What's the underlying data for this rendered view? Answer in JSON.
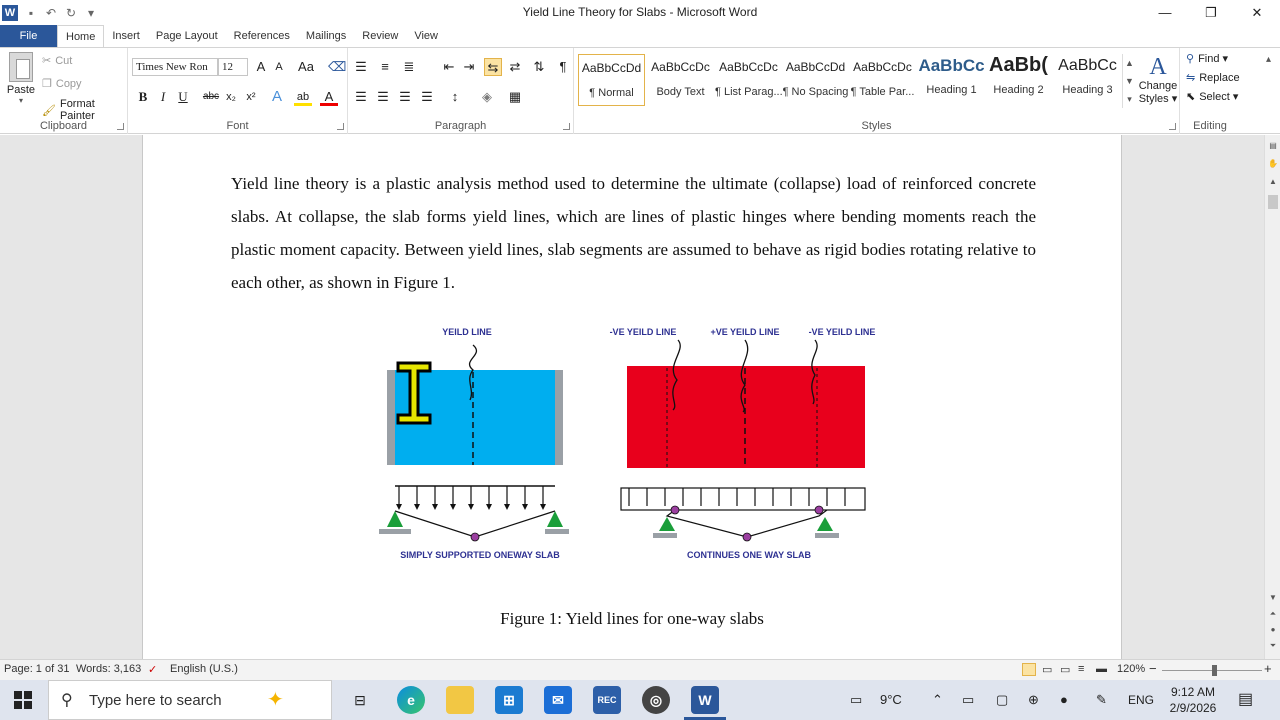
{
  "window": {
    "title": "Yield Line Theory for Slabs - Microsoft Word",
    "logo": "W",
    "minimize": "—",
    "restore": "❐",
    "close": "✕"
  },
  "tabs": [
    "File",
    "Home",
    "Insert",
    "Page Layout",
    "References",
    "Mailings",
    "Review",
    "View"
  ],
  "ribbon": {
    "clipboard": {
      "label": "Clipboard",
      "paste": "Paste",
      "cut": "Cut",
      "copy": "Copy",
      "format_painter": "Format Painter"
    },
    "font": {
      "label": "Font",
      "font_name": "Times New Ron",
      "font_size": "12",
      "grow": "A",
      "shrink": "A",
      "change_case": "Aa",
      "bold": "B",
      "italic": "I",
      "underline": "U",
      "strike": "abc",
      "subscript": "x₂",
      "superscript": "x²",
      "text_effects": "A",
      "highlight": "ab",
      "font_color": "A"
    },
    "paragraph": {
      "label": "Paragraph",
      "pilcrow": "¶"
    },
    "styles": {
      "label": "Styles",
      "items": [
        {
          "sample": "AaBbCcDd",
          "name": "¶ Normal"
        },
        {
          "sample": "AaBbCcDc",
          "name": "Body Text"
        },
        {
          "sample": "AaBbCcDc",
          "name": "¶ List Parag..."
        },
        {
          "sample": "AaBbCcDd",
          "name": "¶ No Spacing"
        },
        {
          "sample": "AaBbCcDc",
          "name": "¶ Table Par..."
        },
        {
          "sample": "AaBbCc",
          "name": "Heading 1"
        },
        {
          "sample": "AaBb(",
          "name": "Heading 2"
        },
        {
          "sample": "AaBbCc",
          "name": "Heading 3"
        }
      ],
      "change_styles_line1": "Change",
      "change_styles_line2": "Styles ▾"
    },
    "editing": {
      "label": "Editing",
      "find": "Find ▾",
      "replace": "Replace",
      "select": "Select ▾"
    }
  },
  "document": {
    "paragraph": "Yield line theory is a plastic analysis method used to determine the ultimate (collapse) load of reinforced concrete slabs. At collapse, the slab forms yield lines, which are lines of plastic hinges where bending moments reach the plastic moment capacity. Between yield lines, slab segments are assumed to behave as rigid bodies rotating relative to each other, as shown in Figure 1.",
    "figure": {
      "left_label": "YEILD LINE",
      "right_label_neg1": "-VE YEILD LINE",
      "right_label_pos": "+VE YEILD LINE",
      "right_label_neg2": "-VE YEILD LINE",
      "left_caption": "SIMPLY SUPPORTED ONEWAY SLAB",
      "right_caption": "CONTINUES ONE WAY SLAB",
      "colors": {
        "left_slab": "#00aeef",
        "right_slab": "#e8001c",
        "support": "#1a9e3a",
        "hinge": "#9b3fa0",
        "label_text": "#2e3192"
      }
    },
    "caption": "Figure 1: Yield lines for one-way slabs"
  },
  "statusbar": {
    "page": "Page: 1 of 31",
    "words": "Words: 3,163",
    "language": "English (U.S.)",
    "zoom": "120%",
    "zoom_out": "−",
    "zoom_in": "+"
  },
  "taskbar": {
    "search_placeholder": "Type here to search",
    "weather": "9°C",
    "lang": "ENG",
    "time": "9:12 AM",
    "date": "2/9/2026"
  }
}
